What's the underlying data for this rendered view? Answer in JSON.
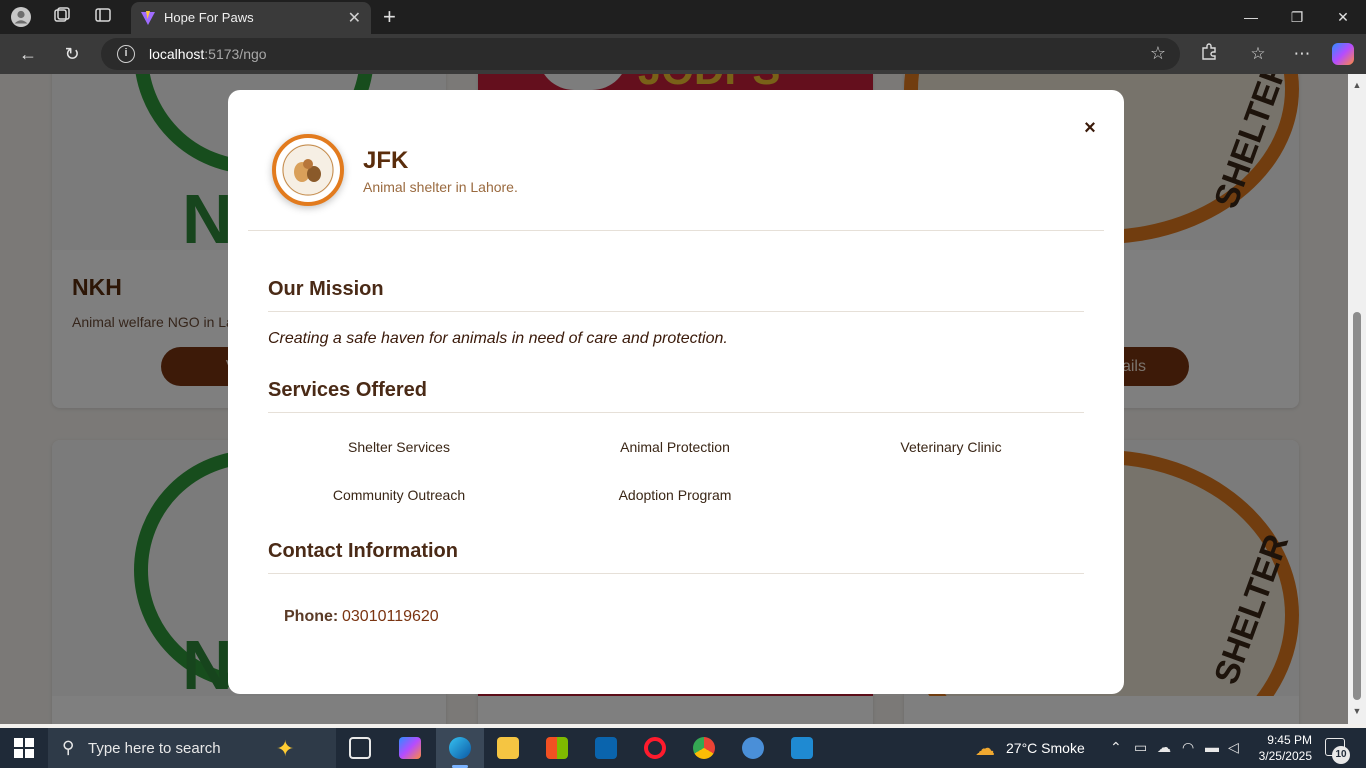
{
  "browser": {
    "tab_title": "Hope For Paws",
    "url_host": "localhost",
    "url_path": ":5173/ngo"
  },
  "background_cards": [
    {
      "title": "NKH",
      "description": "Animal welfare NGO in La",
      "button": "View N"
    },
    {
      "button": "Details"
    }
  ],
  "modal": {
    "close_label": "×",
    "ngo_name": "JFK",
    "ngo_tagline": "Animal shelter in Lahore.",
    "logo_text": "JFK ANIMAL RESCUE AND SHELTER",
    "mission": {
      "title": "Our Mission",
      "text": "Creating a safe haven for animals in need of care and protection."
    },
    "services": {
      "title": "Services Offered",
      "items": [
        "Shelter Services",
        "Animal Protection",
        "Veterinary Clinic",
        "Community Outreach",
        "Adoption Program"
      ]
    },
    "contact": {
      "title": "Contact Information",
      "phone_label": "Phone:",
      "phone_value": "03010119620"
    }
  },
  "taskbar": {
    "search_placeholder": "Type here to search",
    "weather": "27°C  Smoke",
    "time": "9:45 PM",
    "date": "3/25/2025",
    "notification_count": "10"
  }
}
